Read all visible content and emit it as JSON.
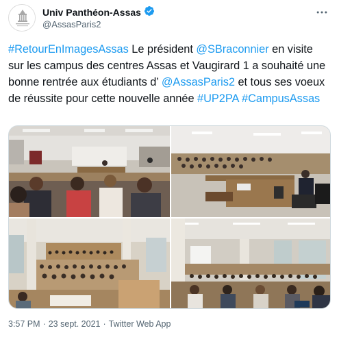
{
  "account": {
    "display_name": "Univ Panthéon-Assas",
    "handle": "@AssasParis2",
    "verified_icon": "verified-badge-icon",
    "more_icon": "more-horizontal-icon"
  },
  "tweet": {
    "segments": [
      {
        "text": "#RetourEnImagesAssas",
        "link": true
      },
      {
        "text": " Le président ",
        "link": false
      },
      {
        "text": "@SBraconnier",
        "link": true
      },
      {
        "text": " en visite sur les campus des centres Assas et Vaugirard 1 a souhaité une bonne rentrée aux étudiants d’ ",
        "link": false
      },
      {
        "text": "@AssasParis2",
        "link": true
      },
      {
        "text": " et tous ses voeux de réussite pour cette nouvelle année ",
        "link": false
      },
      {
        "text": "#UP2PA",
        "link": true
      },
      {
        "text": " ",
        "link": false
      },
      {
        "text": "#CampusAssas",
        "link": true
      }
    ]
  },
  "media": {
    "photos": [
      {
        "name": "photo-lecture-hall-students-front"
      },
      {
        "name": "photo-president-at-podium"
      },
      {
        "name": "photo-amphitheatre-wide"
      },
      {
        "name": "photo-hall-with-screen"
      }
    ]
  },
  "footer": {
    "time": "3:57 PM",
    "separator1": "·",
    "date": "23 sept. 2021",
    "separator2": "·",
    "source": "Twitter Web App"
  },
  "colors": {
    "link": "#1d9bf0",
    "text": "#0f1419",
    "secondary": "#536471"
  }
}
